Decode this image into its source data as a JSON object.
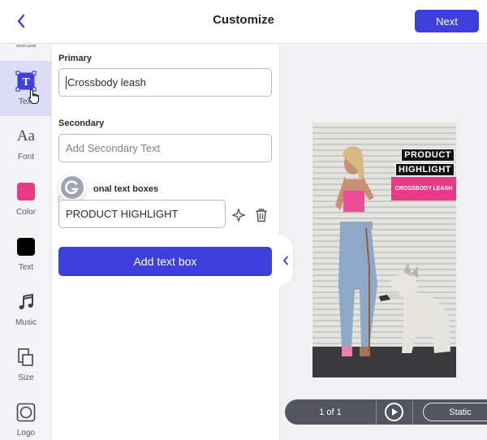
{
  "header": {
    "title": "Customize",
    "next_label": "Next",
    "back_icon": "chevron-left-icon"
  },
  "rail": {
    "cut_label": "Media",
    "items": [
      {
        "label": "Text",
        "icon": "text-tool-icon",
        "active": true
      },
      {
        "label": "Font",
        "icon": "font-icon"
      },
      {
        "label": "Color",
        "icon": "color-swatch",
        "color": "#e93a85"
      },
      {
        "label": "Text",
        "icon": "text-color-swatch",
        "color": "#000000"
      },
      {
        "label": "Music",
        "icon": "music-note-icon"
      },
      {
        "label": "Size",
        "icon": "size-icon"
      },
      {
        "label": "Logo",
        "icon": "logo-icon"
      }
    ]
  },
  "form": {
    "primary_label": "Primary",
    "primary_value": "Crossbody leash",
    "secondary_label": "Secondary",
    "secondary_placeholder": "Add Secondary Text",
    "additional_label": "onal text boxes",
    "additional_value": "PRODUCT HIGHLIGHT",
    "add_button_label": "Add text box"
  },
  "preview": {
    "overlay_line1": "PRODUCT",
    "overlay_line2": "HIGHLIGHT",
    "tag_text": "CROSSBODY LEASH",
    "tag_color": "#ea3a86",
    "page_indicator": "1 of 1",
    "mode_label": "Static"
  },
  "colors": {
    "accent": "#3d3fdc",
    "active_nav_bg": "#dcdcf6"
  }
}
